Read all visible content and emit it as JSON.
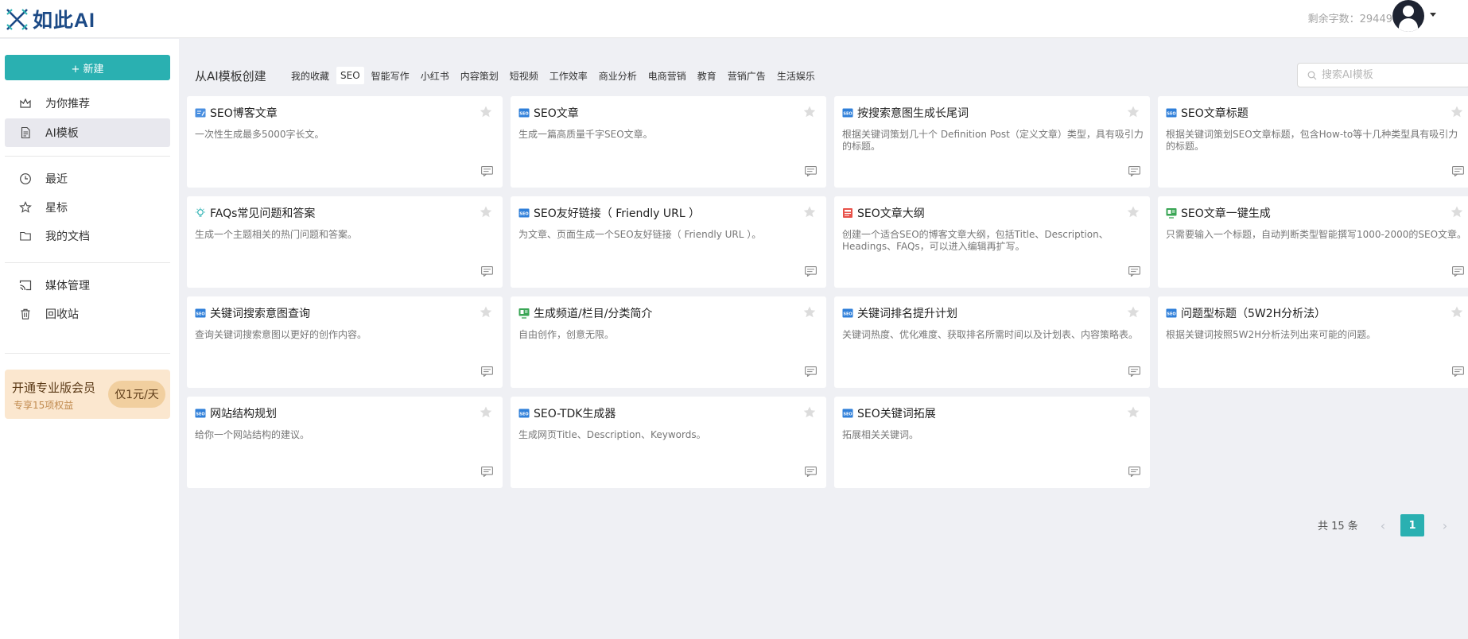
{
  "header": {
    "logo_text": "如此AI",
    "quota_label": "剩余字数：29449字"
  },
  "sidebar": {
    "new_label": "+ 新建",
    "items": [
      {
        "label": "为你推荐",
        "icon": "crown-icon"
      },
      {
        "label": "AI模板",
        "icon": "document-icon",
        "active": true
      },
      {
        "label": "最近",
        "icon": "clock-icon"
      },
      {
        "label": "星标",
        "icon": "star-icon"
      },
      {
        "label": "我的文档",
        "icon": "folder-icon"
      },
      {
        "label": "媒体管理",
        "icon": "cast-icon"
      },
      {
        "label": "回收站",
        "icon": "trash-icon"
      }
    ],
    "vip": {
      "title": "开通专业版会员",
      "subtitle": "专享15项权益",
      "price": "仅1元/天"
    }
  },
  "main": {
    "title": "从AI模板创建",
    "tabs": [
      "我的收藏",
      "SEO",
      "智能写作",
      "小红书",
      "内容策划",
      "短视频",
      "工作效率",
      "商业分析",
      "电商营销",
      "教育",
      "营销广告",
      "生活娱乐"
    ],
    "active_tab": "SEO",
    "search_placeholder": "搜索AI模板",
    "cards": [
      {
        "title": "SEO博客文章",
        "desc": "一次性生成最多5000字长文。",
        "icon": "edit-icon"
      },
      {
        "title": "SEO文章",
        "desc": "生成一篇高质量千字SEO文章。",
        "icon": "seo-icon"
      },
      {
        "title": "按搜索意图生成长尾词",
        "desc": "根据关键词策划几十个 Definition Post（定义文章）类型，具有吸引力的标题。",
        "icon": "seo-icon"
      },
      {
        "title": "SEO文章标题",
        "desc": "根据关键词策划SEO文章标题，包含How-to等十几种类型具有吸引力的标题。",
        "icon": "seo-icon"
      },
      {
        "title": "FAQs常见问题和答案",
        "desc": "生成一个主题相关的热门问题和答案。",
        "icon": "bulb-icon"
      },
      {
        "title": "SEO友好链接（ Friendly URL ）",
        "desc": "为文章、页面生成一个SEO友好链接（ Friendly URL ）。",
        "icon": "seo-icon"
      },
      {
        "title": "SEO文章大纲",
        "desc": "创建一个适合SEO的博客文章大纲，包括Title、Description、Headings、FAQs，可以进入编辑再扩写。",
        "icon": "outline-icon"
      },
      {
        "title": "SEO文章一键生成",
        "desc": "只需要输入一个标题，自动判断类型智能撰写1000-2000的SEO文章。",
        "icon": "screen-icon"
      },
      {
        "title": "关键词搜索意图查询",
        "desc": "查询关键词搜索意图以更好的创作内容。",
        "icon": "seo-icon"
      },
      {
        "title": "生成频道/栏目/分类简介",
        "desc": "自由创作，创意无限。",
        "icon": "screen-icon"
      },
      {
        "title": "关键词排名提升计划",
        "desc": "关键词热度、优化难度、获取排名所需时间以及计划表、内容策略表。",
        "icon": "seo-icon"
      },
      {
        "title": "问题型标题（5W2H分析法）",
        "desc": "根据关键词按照5W2H分析法列出来可能的问题。",
        "icon": "seo-icon"
      },
      {
        "title": "网站结构规划",
        "desc": "给你一个网站结构的建议。",
        "icon": "seo-icon"
      },
      {
        "title": "SEO-TDK生成器",
        "desc": "生成网页Title、Description、Keywords。",
        "icon": "seo-icon"
      },
      {
        "title": "SEO关键词拓展",
        "desc": "拓展相关关键词。",
        "icon": "seo-icon"
      }
    ]
  },
  "pagination": {
    "total_label": "共 15 条",
    "current_page": "1"
  },
  "colors": {
    "accent": "#2ab0b1",
    "logo": "#1c4a86",
    "seo_badge": "#2f7fd9"
  }
}
